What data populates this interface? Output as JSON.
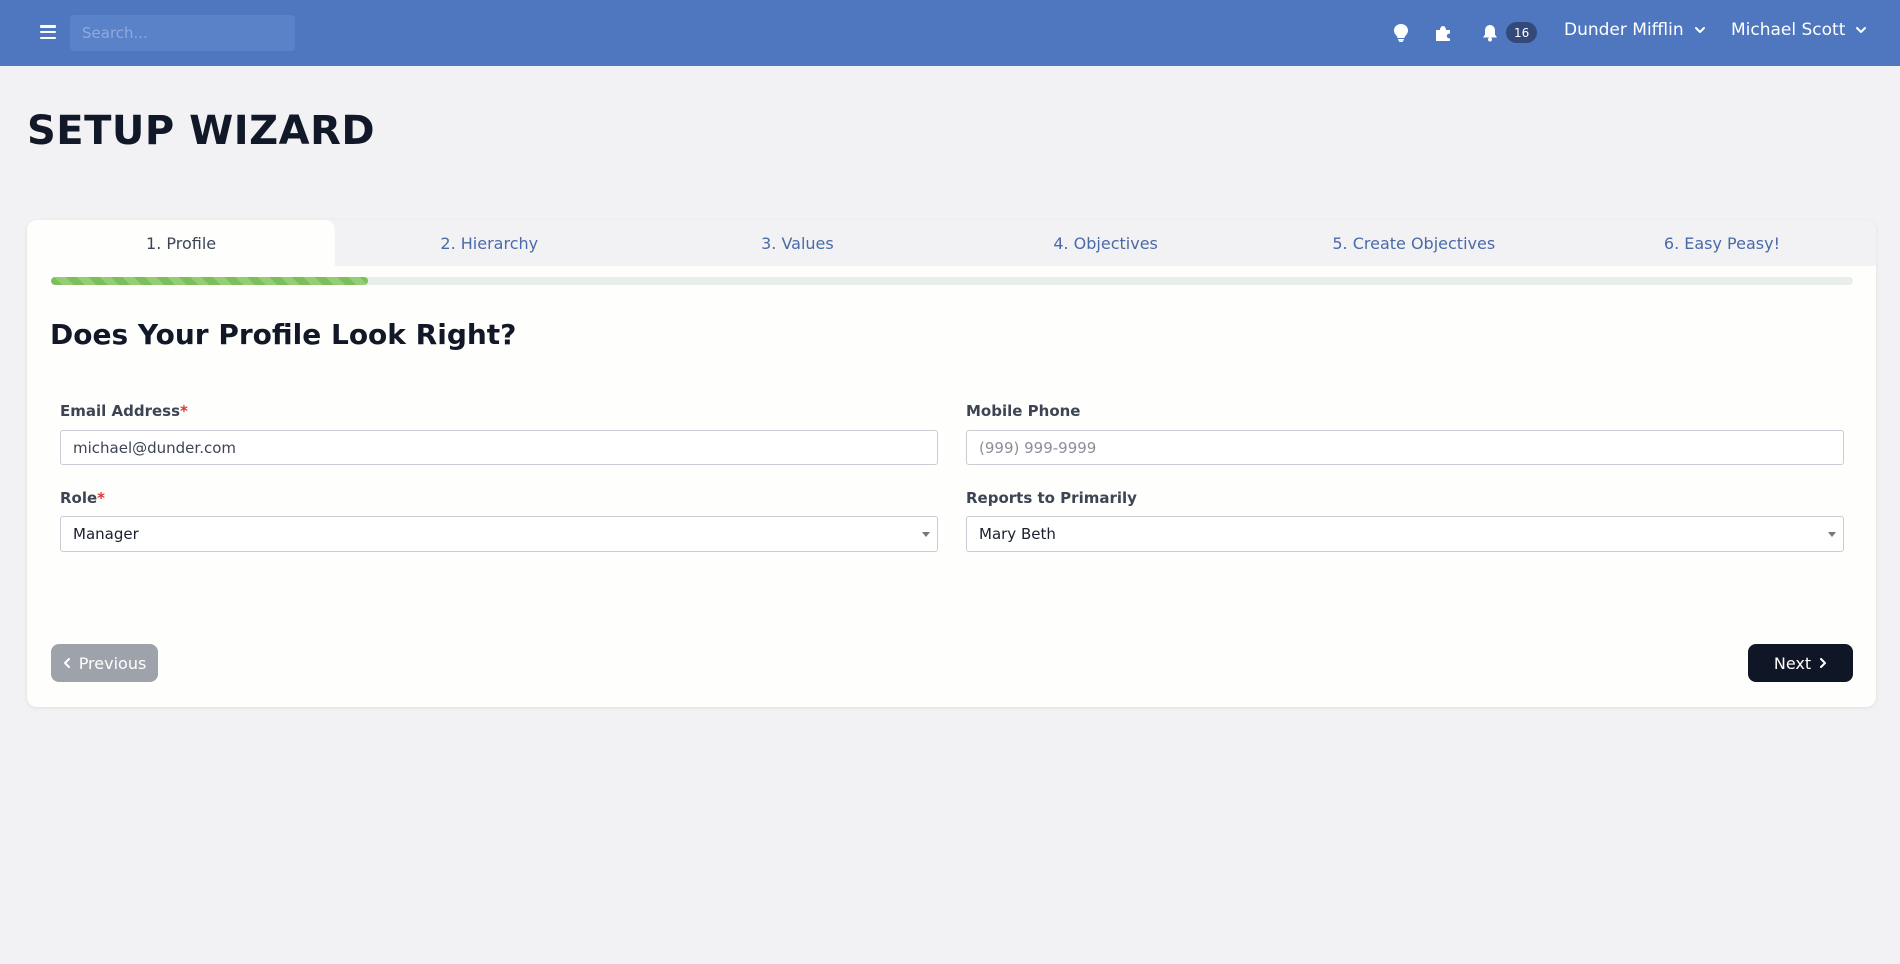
{
  "topbar": {
    "search_placeholder": "Search...",
    "notifications_count": "16",
    "org_menu_label": "Dunder Mifflin",
    "user_menu_label": "Michael Scott",
    "icons": [
      "menu-icon",
      "lightbulb-icon",
      "puzzle-icon",
      "bell-icon",
      "chevron-down-icon"
    ]
  },
  "page": {
    "title": "SETUP WIZARD"
  },
  "wizard": {
    "tabs": [
      {
        "label": "1. Profile",
        "active": true
      },
      {
        "label": "2. Hierarchy",
        "active": false
      },
      {
        "label": "3. Values",
        "active": false
      },
      {
        "label": "4. Objectives",
        "active": false
      },
      {
        "label": "5. Create Objectives",
        "active": false
      },
      {
        "label": "6. Easy Peasy!",
        "active": false
      }
    ],
    "progress_percent": 17.6,
    "section_title": "Does Your Profile Look Right?",
    "fields": {
      "email": {
        "label": "Email Address",
        "required_mark": "*",
        "value": "michael@dunder.com"
      },
      "mobile": {
        "label": "Mobile Phone",
        "placeholder": "(999) 999-9999",
        "value": ""
      },
      "role": {
        "label": "Role",
        "required_mark": "*",
        "value": "Manager"
      },
      "reports_to": {
        "label": "Reports to Primarily",
        "value": "Mary Beth"
      }
    },
    "buttons": {
      "previous_label": "Previous",
      "next_label": "Next"
    }
  },
  "colors": {
    "topbar_bg": "#4e77c0",
    "progress_green": "#7cbf5a",
    "next_button_bg": "#0f1726",
    "prev_button_bg": "#9ea3ab",
    "required_red": "#dd3333",
    "tab_link_blue": "#4a6aa8"
  }
}
